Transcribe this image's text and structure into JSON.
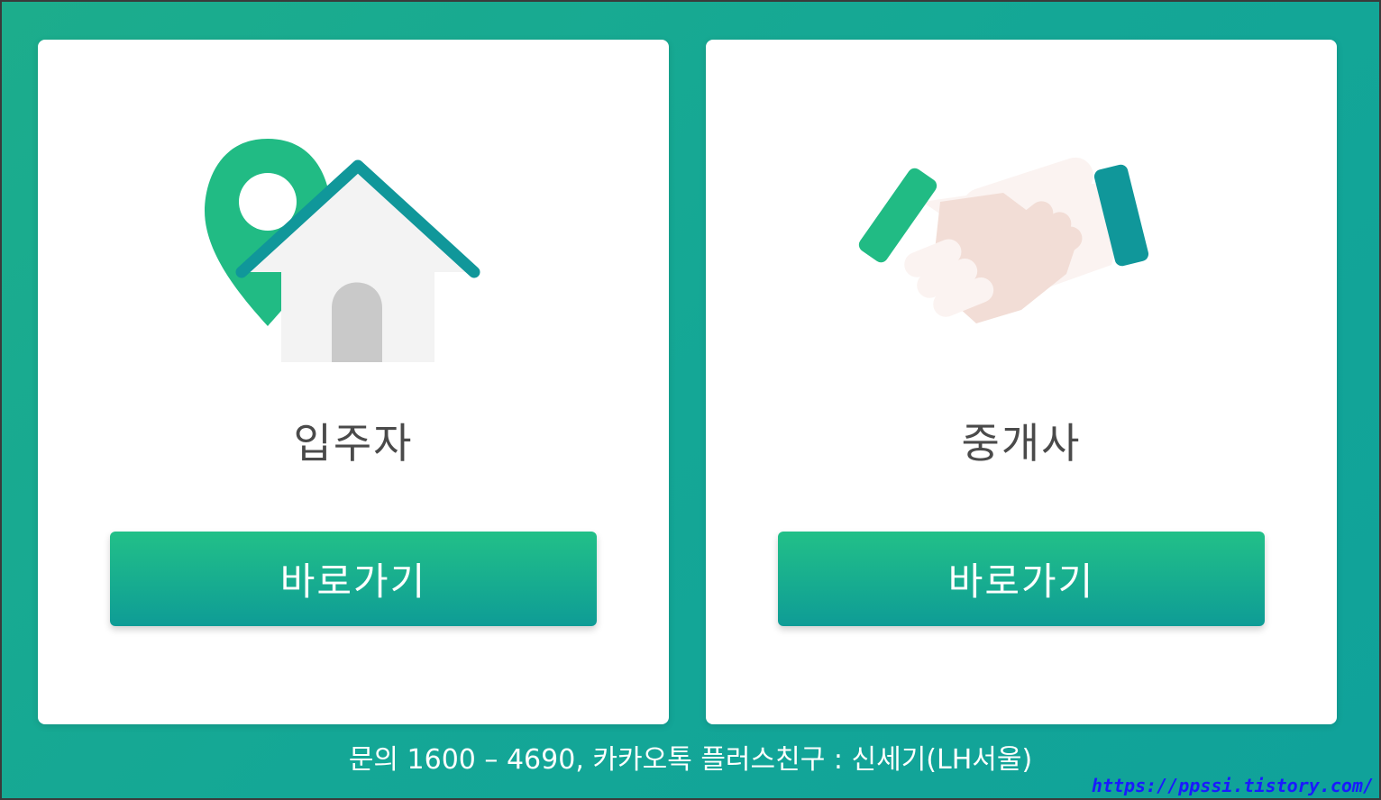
{
  "cards": [
    {
      "title": "입주자",
      "button_label": "바로가기",
      "icon": "house-location-icon"
    },
    {
      "title": "중개사",
      "button_label": "바로가기",
      "icon": "handshake-icon"
    }
  ],
  "footer": {
    "text": "문의 1600 – 4690,    카카오톡 플러스친구 : 신세기(LH서울)"
  },
  "watermark": {
    "text": "https://ppssi.tistory.com/"
  },
  "colors": {
    "background": "#14a796",
    "button_top": "#22c088",
    "button_bottom": "#0e9c96",
    "title_text": "#4a4a4a"
  }
}
